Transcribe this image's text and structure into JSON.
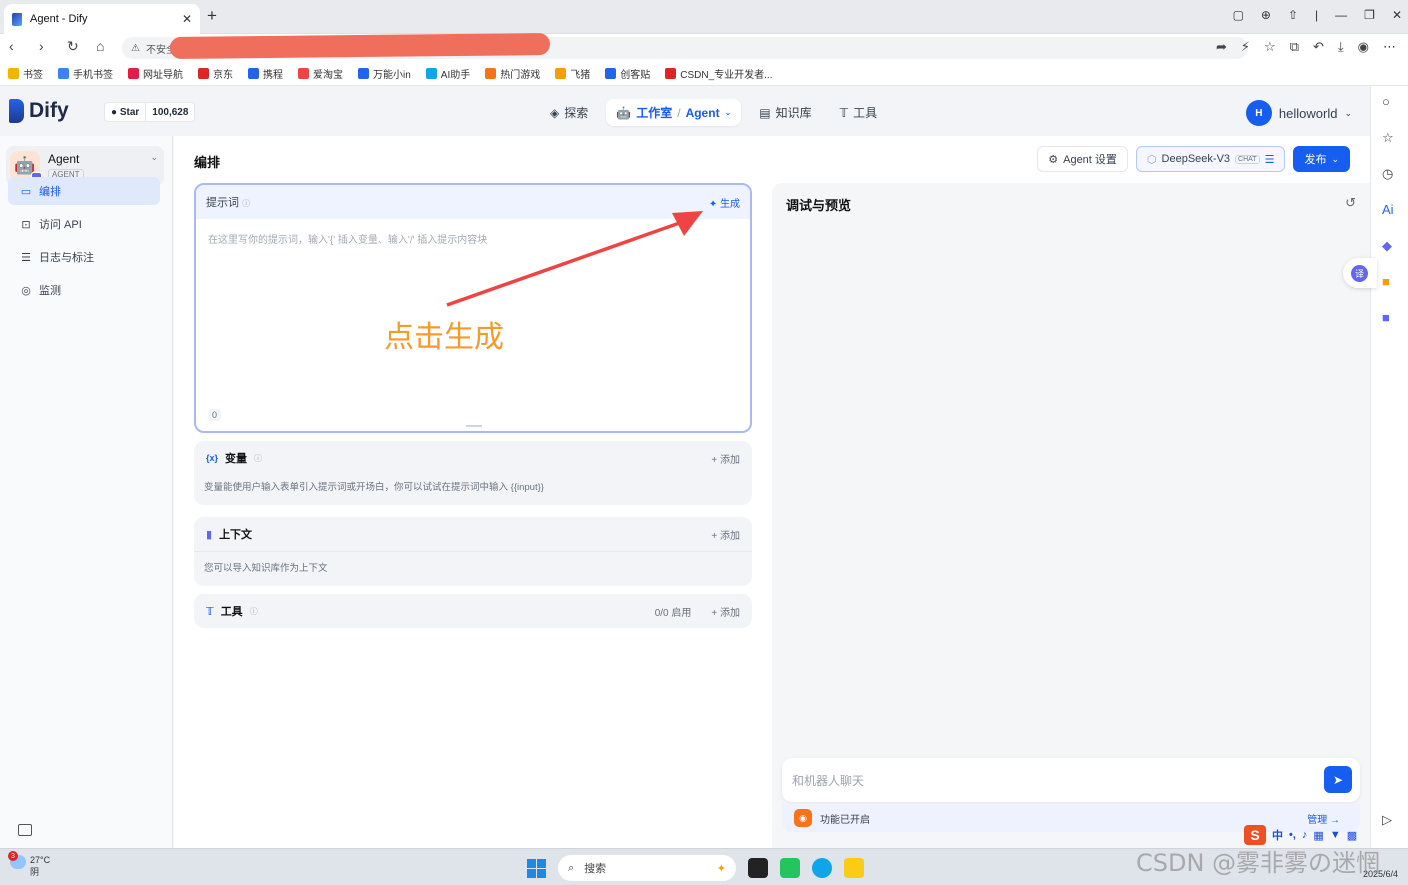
{
  "browser": {
    "tab_title": "Agent - Dify",
    "tab_close": "✕",
    "new_tab": "+",
    "security": "不安全",
    "url_hidden": "",
    "bookmarks": [
      {
        "label": "书签",
        "color": "#f5b301"
      },
      {
        "label": "手机书签",
        "color": "#3b82f6"
      },
      {
        "label": "网址导航",
        "color": "#e11d48"
      },
      {
        "label": "京东",
        "color": "#dc2626"
      },
      {
        "label": "携程",
        "color": "#2563eb"
      },
      {
        "label": "爱淘宝",
        "color": "#ef4444"
      },
      {
        "label": "万能小in",
        "color": "#2563eb"
      },
      {
        "label": "AI助手",
        "color": "#0ea5e9"
      },
      {
        "label": "热门游戏",
        "color": "#f97316"
      },
      {
        "label": "飞猪",
        "color": "#f59e0b"
      },
      {
        "label": "创客贴",
        "color": "#2563eb"
      },
      {
        "label": "CSDN_专业开发者...",
        "color": "#dc2626"
      }
    ]
  },
  "app": {
    "logo_text": "Dify",
    "github_star": "Star",
    "github_count": "100,628",
    "nav": {
      "explore": "探索",
      "studio": "工作室",
      "separator": "/",
      "agent": "Agent",
      "knowledge": "知识库",
      "tools": "工具"
    },
    "user": {
      "avatar": "H",
      "name": "helloworld"
    }
  },
  "sidebar": {
    "agent_name": "Agent",
    "agent_tag": "AGENT",
    "items": [
      {
        "label": "编排",
        "icon": "▭"
      },
      {
        "label": "访问 API",
        "icon": "⊡"
      },
      {
        "label": "日志与标注",
        "icon": "☰"
      },
      {
        "label": "监测",
        "icon": "◎"
      }
    ]
  },
  "main": {
    "title": "编排",
    "agent_settings": "Agent 设置",
    "model_name": "DeepSeek-V3",
    "model_mode": "CHAT",
    "publish": "发布",
    "prompt": {
      "label": "提示词",
      "generate": "生成",
      "placeholder": "在这里写你的提示词，输入'{' 插入变量、输入'/' 插入提示内容块",
      "count": "0"
    },
    "variables": {
      "title": "变量",
      "add": "添加",
      "desc": "变量能使用户输入表单引入提示词或开场白，你可以试试在提示词中输入 {{input}}"
    },
    "context": {
      "title": "上下文",
      "add": "添加",
      "desc": "您可以导入知识库作为上下文"
    },
    "tools": {
      "title": "工具",
      "enabled": "0/0 启用",
      "add": "添加"
    },
    "annotation": "点击生成"
  },
  "preview": {
    "title": "调试与预览",
    "chat_placeholder": "和机器人聊天",
    "features_on": "功能已开启",
    "manage": "管理"
  },
  "taskbar": {
    "temp": "27°C",
    "weather": "阴",
    "weather_badge": "3",
    "search": "搜索",
    "date": "2025/6/4",
    "ime_lang": "中"
  },
  "watermark": "CSDN @雾非雾の迷惘"
}
